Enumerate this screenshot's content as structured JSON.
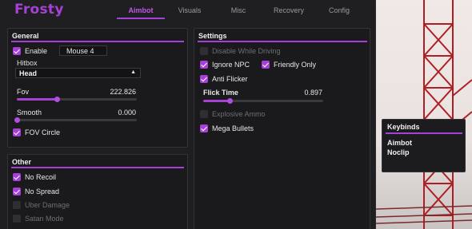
{
  "app": {
    "title": "Frosty"
  },
  "tabs": [
    {
      "label": "Aimbot",
      "active": true
    },
    {
      "label": "Visuals",
      "active": false
    },
    {
      "label": "Misc",
      "active": false
    },
    {
      "label": "Recovery",
      "active": false
    },
    {
      "label": "Config",
      "active": false
    }
  ],
  "general": {
    "title": "General",
    "enable": {
      "label": "Enable",
      "checked": true,
      "key": "Mouse 4"
    },
    "hitbox": {
      "label": "Hitbox",
      "value": "Head",
      "arrow": "▲"
    },
    "fov": {
      "label": "Fov",
      "value": "222.826",
      "fraction": 0.33
    },
    "smooth": {
      "label": "Smooth",
      "value": "0.000",
      "fraction": 0.0
    },
    "fov_circle": {
      "label": "FOV Circle",
      "checked": true
    }
  },
  "other": {
    "title": "Other",
    "items": [
      {
        "label": "No Recoil",
        "checked": true
      },
      {
        "label": "No Spread",
        "checked": true
      },
      {
        "label": "Uber Damage",
        "checked": false
      },
      {
        "label": "Satan Mode",
        "checked": false
      }
    ]
  },
  "settings": {
    "title": "Settings",
    "disable_while_driving": {
      "label": "Disable While Driving",
      "checked": false
    },
    "ignore_npc": {
      "label": "Ignore NPC",
      "checked": true
    },
    "friendly_only": {
      "label": "Friendly Only",
      "checked": true
    },
    "anti_flicker": {
      "label": "Anti Flicker",
      "checked": true
    },
    "flick_time": {
      "label": "Flick Time",
      "value": "0.897",
      "fraction": 0.22
    },
    "explosive_ammo": {
      "label": "Explosive Ammo",
      "checked": false
    },
    "mega_bullets": {
      "label": "Mega Bullets",
      "checked": true
    }
  },
  "keybinds": {
    "title": "Keybinds",
    "items": [
      "Aimbot",
      "Noclip"
    ]
  },
  "colors": {
    "accent": "#a640d6",
    "panel": "#1a191c",
    "background": "#1f1e21"
  }
}
